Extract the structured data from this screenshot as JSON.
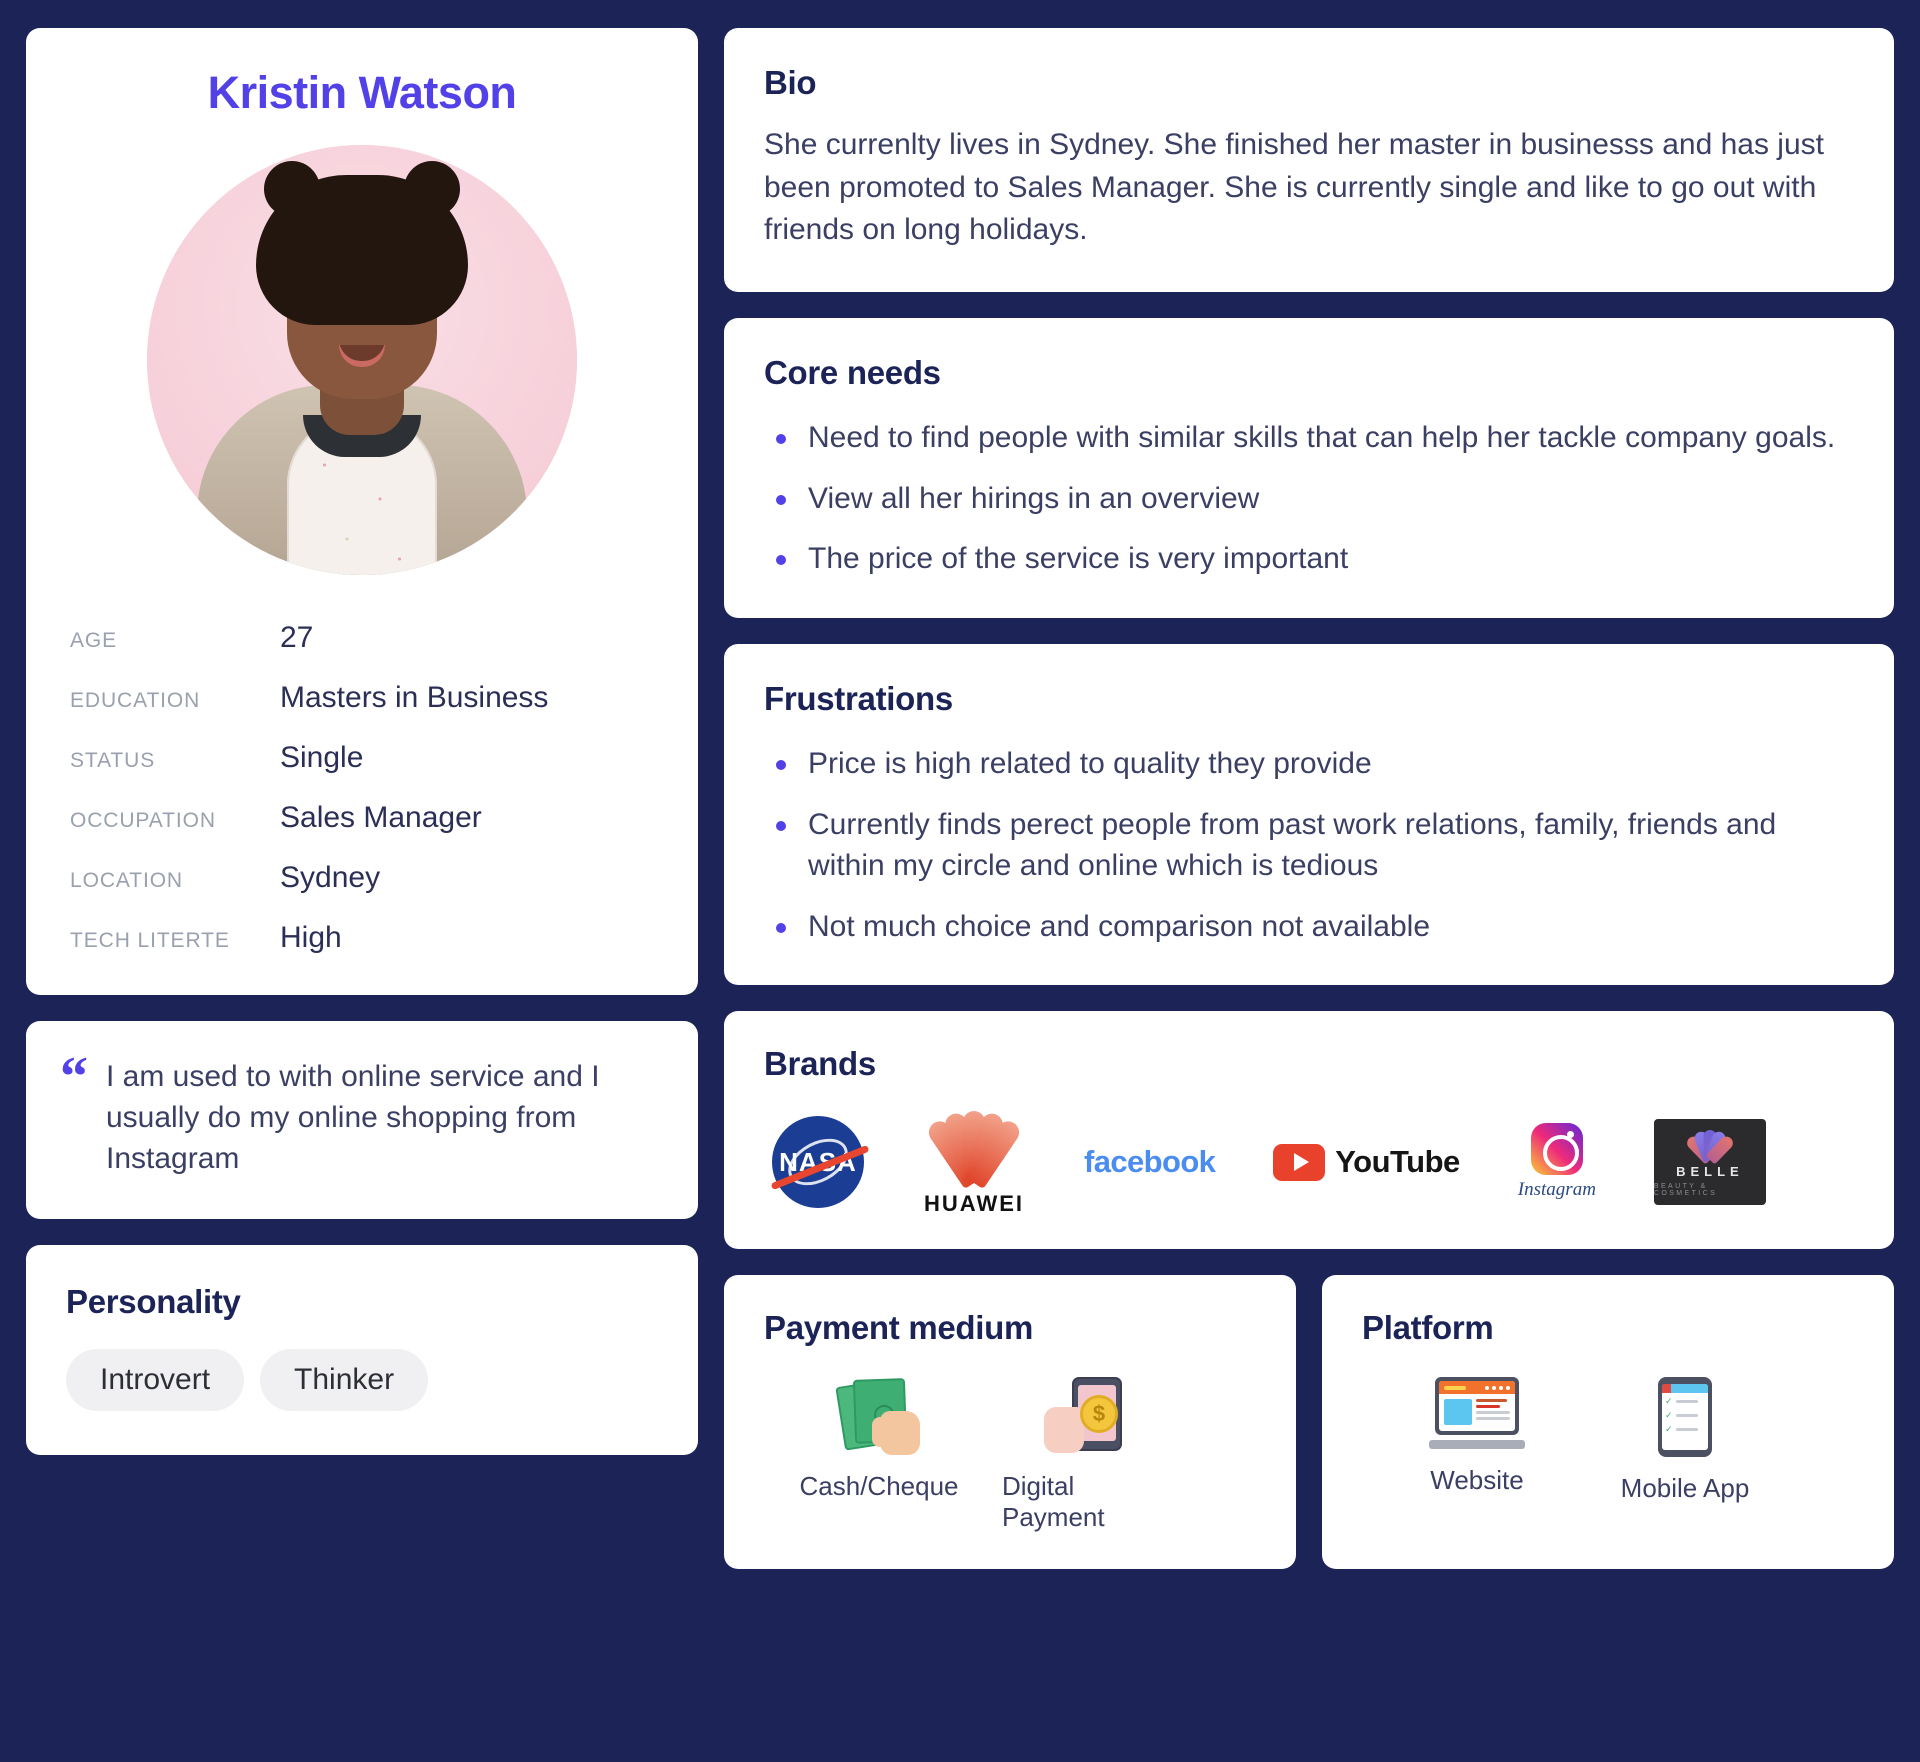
{
  "profile": {
    "name": "Kristin Watson",
    "avatar_alt": "portrait-photo",
    "facts": [
      {
        "label": "AGE",
        "value": "27"
      },
      {
        "label": "EDUCATION",
        "value": "Masters in Business"
      },
      {
        "label": "STATUS",
        "value": "Single"
      },
      {
        "label": "OCCUPATION",
        "value": "Sales Manager"
      },
      {
        "label": "LOCATION",
        "value": "Sydney"
      },
      {
        "label": "TECH  LITERTE",
        "value": "High"
      }
    ]
  },
  "quote": {
    "mark": "“",
    "text": "I am used to with online service and I usually do my online shopping from Instagram"
  },
  "personality": {
    "title": "Personality",
    "tags": [
      "Introvert",
      "Thinker"
    ]
  },
  "bio": {
    "title": "Bio",
    "text": "She currenlty lives in Sydney. She finished her master in businesss and has just been promoted to Sales Manager. She is currently single and like to go out with friends on long holidays."
  },
  "core_needs": {
    "title": "Core needs",
    "items": [
      "Need to find people with similar skills that can help her tackle company goals.",
      "View all her hirings in an overview",
      "The price of the service is very important"
    ]
  },
  "frustrations": {
    "title": "Frustrations",
    "items": [
      "Price is high related to quality they provide",
      "Currently finds perect people from past work relations, family, friends and within my circle and online which is tedious",
      "Not much choice and comparison not available"
    ]
  },
  "brands": {
    "title": "Brands",
    "items": [
      {
        "name": "NASA",
        "icon": "nasa-logo",
        "word": "NASA"
      },
      {
        "name": "Huawei",
        "icon": "huawei-logo",
        "word": "HUAWEI"
      },
      {
        "name": "Facebook",
        "icon": "facebook-logo",
        "word": "facebook"
      },
      {
        "name": "YouTube",
        "icon": "youtube-logo",
        "word": "YouTube"
      },
      {
        "name": "Instagram",
        "icon": "instagram-logo",
        "word": "Instagram"
      },
      {
        "name": "Belle",
        "icon": "belle-logo",
        "word": "BELLE",
        "sub": "BEAUTY & COSMETICS"
      }
    ]
  },
  "payment_medium": {
    "title": "Payment medium",
    "items": [
      {
        "label": "Cash/Cheque",
        "icon": "cash-icon"
      },
      {
        "label": "Digital Payment",
        "icon": "digital-payment-icon"
      }
    ]
  },
  "platform": {
    "title": "Platform",
    "items": [
      {
        "label": "Website",
        "icon": "laptop-icon"
      },
      {
        "label": "Mobile App",
        "icon": "mobile-phone-icon"
      }
    ]
  },
  "colors": {
    "background": "#1c2356",
    "accent": "#5341e8",
    "heading": "#1c2356",
    "body_text": "#3b3f63",
    "label_text": "#9aa0ad",
    "card": "#ffffff",
    "tag_bg": "#f0f0f2"
  }
}
